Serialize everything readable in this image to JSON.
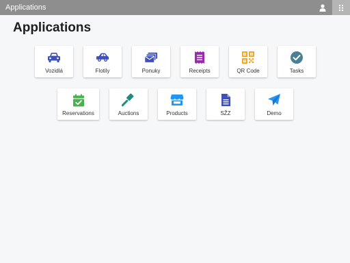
{
  "header": {
    "title": "Applications",
    "user_icon": "user-icon",
    "apps_icon": "apps-grid-icon"
  },
  "page": {
    "title": "Applications"
  },
  "tiles": {
    "vozidla": {
      "label": "Vozidlá",
      "icon": "car-icon",
      "color": "#3f51b5"
    },
    "flotily": {
      "label": "Flotily",
      "icon": "car-side-icon",
      "color": "#3f51b5"
    },
    "ponuky": {
      "label": "Ponuky",
      "icon": "envelope-stack-icon",
      "color": "#3f51b5"
    },
    "receipts": {
      "label": "Receipts",
      "icon": "receipt-icon",
      "color": "#9c27b0"
    },
    "qrcode": {
      "label": "QR Code",
      "icon": "qr-code-icon",
      "color": "#f5a623"
    },
    "tasks": {
      "label": "Tasks",
      "icon": "check-circle-icon",
      "color": "#4a7f96"
    },
    "reservations": {
      "label": "Reservations",
      "icon": "calendar-check-icon",
      "color": "#4caf50"
    },
    "auctions": {
      "label": "Auctions",
      "icon": "gavel-icon",
      "color": "#1e8c7e"
    },
    "products": {
      "label": "Products",
      "icon": "store-icon",
      "color": "#2196f3"
    },
    "szz": {
      "label": "SŽZ",
      "icon": "document-icon",
      "color": "#3f51b5"
    },
    "demo": {
      "label": "Demo",
      "icon": "paper-plane-icon",
      "color": "#2196f3"
    }
  }
}
